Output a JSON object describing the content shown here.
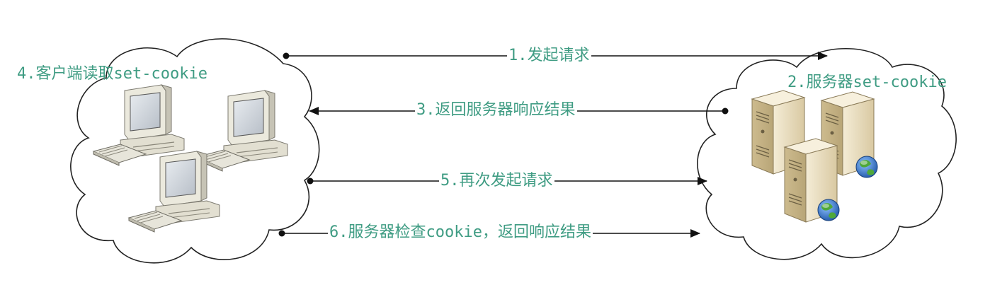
{
  "colors": {
    "label_text": "#3f9c83",
    "line": "#111111",
    "cloud_stroke": "#222222",
    "monitor_beige": "#e9e7dc",
    "monitor_screen": "#d3d8de",
    "server_body": "#eadfc2",
    "globe_blue": "#2e6fc2",
    "globe_green": "#4fa83a"
  },
  "client": {
    "label": "4.客户端读取set-cookie",
    "icons": [
      "computer-icon",
      "computer-icon",
      "computer-icon"
    ]
  },
  "server": {
    "label": "2.服务器set-cookie",
    "icons": [
      "server-icon",
      "server-icon",
      "server-icon",
      "globe-icon"
    ]
  },
  "arrows": [
    {
      "label": "1.发起请求",
      "direction": "right"
    },
    {
      "label": "3.返回服务器响应结果",
      "direction": "left"
    },
    {
      "label": "5.再次发起请求",
      "direction": "right"
    },
    {
      "label": "6.服务器检查cookie，返回响应结果",
      "direction": "right"
    }
  ]
}
